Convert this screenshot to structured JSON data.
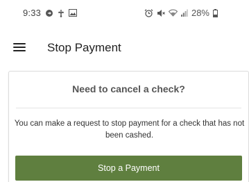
{
  "status_bar": {
    "time": "9:33",
    "battery": "28%",
    "left_icons": [
      "circle-arrow-icon",
      "usb-icon",
      "image-icon"
    ],
    "right_icons": [
      "alarm-icon",
      "mute-icon",
      "wifi-icon",
      "signal-icon",
      "battery-icon"
    ]
  },
  "app_bar": {
    "title": "Stop Payment",
    "menu_icon": "hamburger-menu-icon"
  },
  "card": {
    "title": "Need to cancel a check?",
    "body": "You can make a request to stop payment for a check that has not been cashed.",
    "button_label": "Stop a Payment"
  },
  "colors": {
    "primary_button": "#5f7f3f",
    "card_border": "#dcdcdc",
    "title_text": "#555555"
  }
}
